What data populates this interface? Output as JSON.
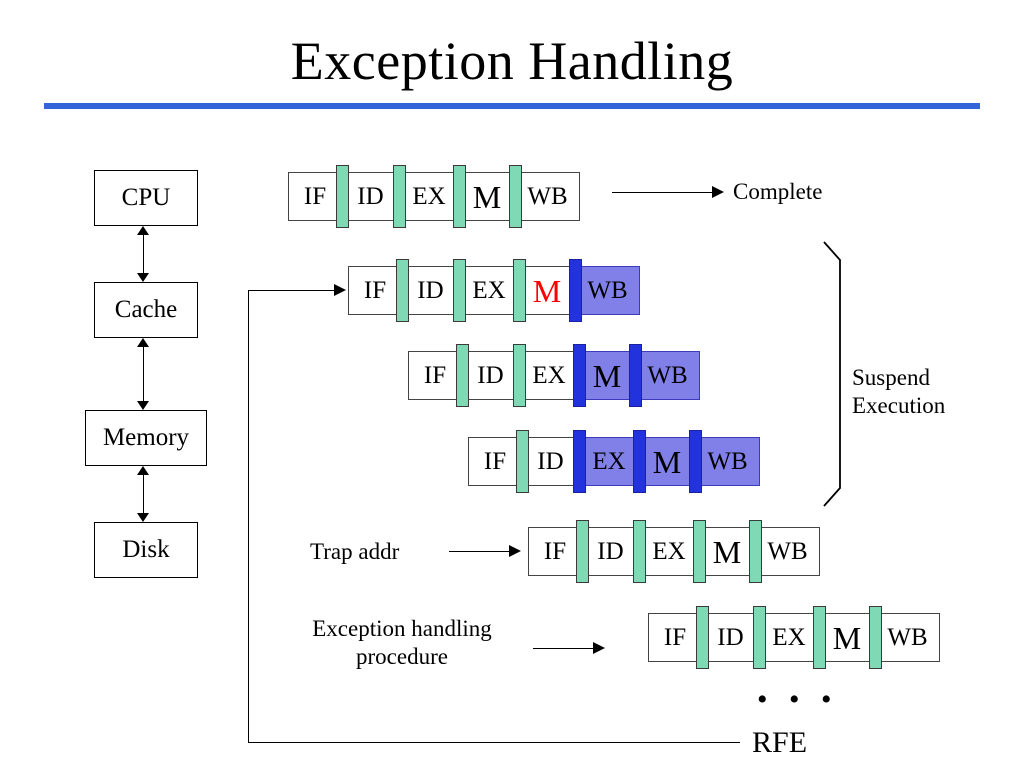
{
  "slide": {
    "title": "Exception Handling",
    "rule_color": "#3465d8"
  },
  "hierarchy": {
    "boxes": [
      {
        "label": "CPU"
      },
      {
        "label": "Cache"
      },
      {
        "label": "Memory"
      },
      {
        "label": "Disk"
      }
    ]
  },
  "colors": {
    "separator_normal": "#7fd9b5",
    "separator_suspended": "#2233dd",
    "stage_suspended_fill": "#8080e8",
    "exception_stage_text": "#ff0000"
  },
  "pipelines": [
    {
      "id": "row-1-complete",
      "stages": [
        {
          "label": "IF"
        },
        {
          "label": "ID"
        },
        {
          "label": "EX"
        },
        {
          "label": "M"
        },
        {
          "label": "WB"
        }
      ]
    },
    {
      "id": "row-2-exception",
      "stages": [
        {
          "label": "IF"
        },
        {
          "label": "ID"
        },
        {
          "label": "EX"
        },
        {
          "label": "M"
        },
        {
          "label": "WB"
        }
      ]
    },
    {
      "id": "row-3-suspended",
      "stages": [
        {
          "label": "IF"
        },
        {
          "label": "ID"
        },
        {
          "label": "EX"
        },
        {
          "label": "M"
        },
        {
          "label": "WB"
        }
      ]
    },
    {
      "id": "row-4-suspended",
      "stages": [
        {
          "label": "IF"
        },
        {
          "label": "ID"
        },
        {
          "label": "EX"
        },
        {
          "label": "M"
        },
        {
          "label": "WB"
        }
      ]
    },
    {
      "id": "row-5-trap-handler",
      "stages": [
        {
          "label": "IF"
        },
        {
          "label": "ID"
        },
        {
          "label": "EX"
        },
        {
          "label": "M"
        },
        {
          "label": "WB"
        }
      ]
    },
    {
      "id": "row-6-handler-procedure",
      "stages": [
        {
          "label": "IF"
        },
        {
          "label": "ID"
        },
        {
          "label": "EX"
        },
        {
          "label": "M"
        },
        {
          "label": "WB"
        }
      ]
    }
  ],
  "annotations": {
    "complete": "Complete",
    "suspend_execution_line1": "Suspend",
    "suspend_execution_line2": "Execution",
    "trap_addr": "Trap addr",
    "exception_procedure_line1": "Exception handling",
    "exception_procedure_line2": "procedure",
    "ellipsis": "• • •",
    "rfe": "RFE"
  }
}
